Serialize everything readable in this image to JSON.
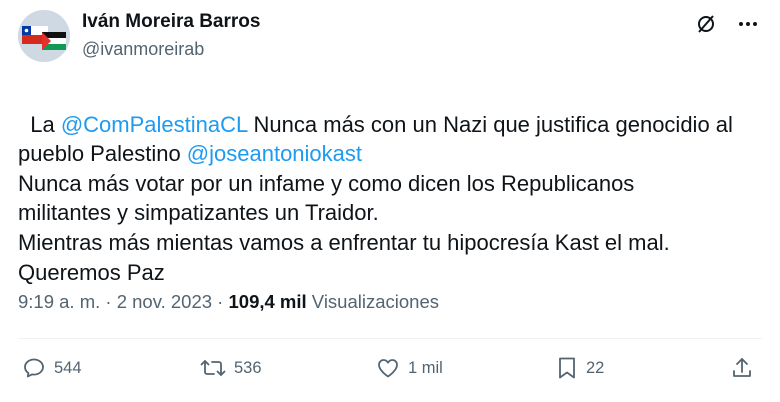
{
  "author": {
    "display_name": "Iván Moreira Barros",
    "handle": "@ivanmoreirab"
  },
  "tweet": {
    "segments": [
      {
        "text": "La ",
        "mention": false
      },
      {
        "text": "@ComPalestinaCL",
        "mention": true
      },
      {
        "text": " Nunca más con un Nazi que justifica genocidio al\npueblo Palestino ",
        "mention": false
      },
      {
        "text": "@joseantoniokast",
        "mention": true
      },
      {
        "text": "\nNunca más votar por un infame y como dicen los Republicanos\nmilitantes y simpatizantes un Traidor.\nMientras más mientas vamos a enfrentar tu hipocresía Kast el mal.\nQueremos Paz",
        "mention": false
      }
    ]
  },
  "meta": {
    "time": "9:19 a. m.",
    "sep1": " · ",
    "date": "2 nov. 2023",
    "sep2": " · ",
    "views_count": "109,4 mil",
    "views_label": " Visualizaciones"
  },
  "actions": {
    "replies": "544",
    "reposts": "536",
    "likes": "1 mil",
    "bookmarks": "22"
  },
  "colors": {
    "link": "#1d9bf0",
    "text": "#0f1419",
    "muted": "#536471"
  },
  "icons": {
    "grok": "grok-icon",
    "more": "more-icon",
    "reply": "reply-icon",
    "repost": "repost-icon",
    "like": "heart-icon",
    "bookmark": "bookmark-icon",
    "share": "share-icon"
  }
}
